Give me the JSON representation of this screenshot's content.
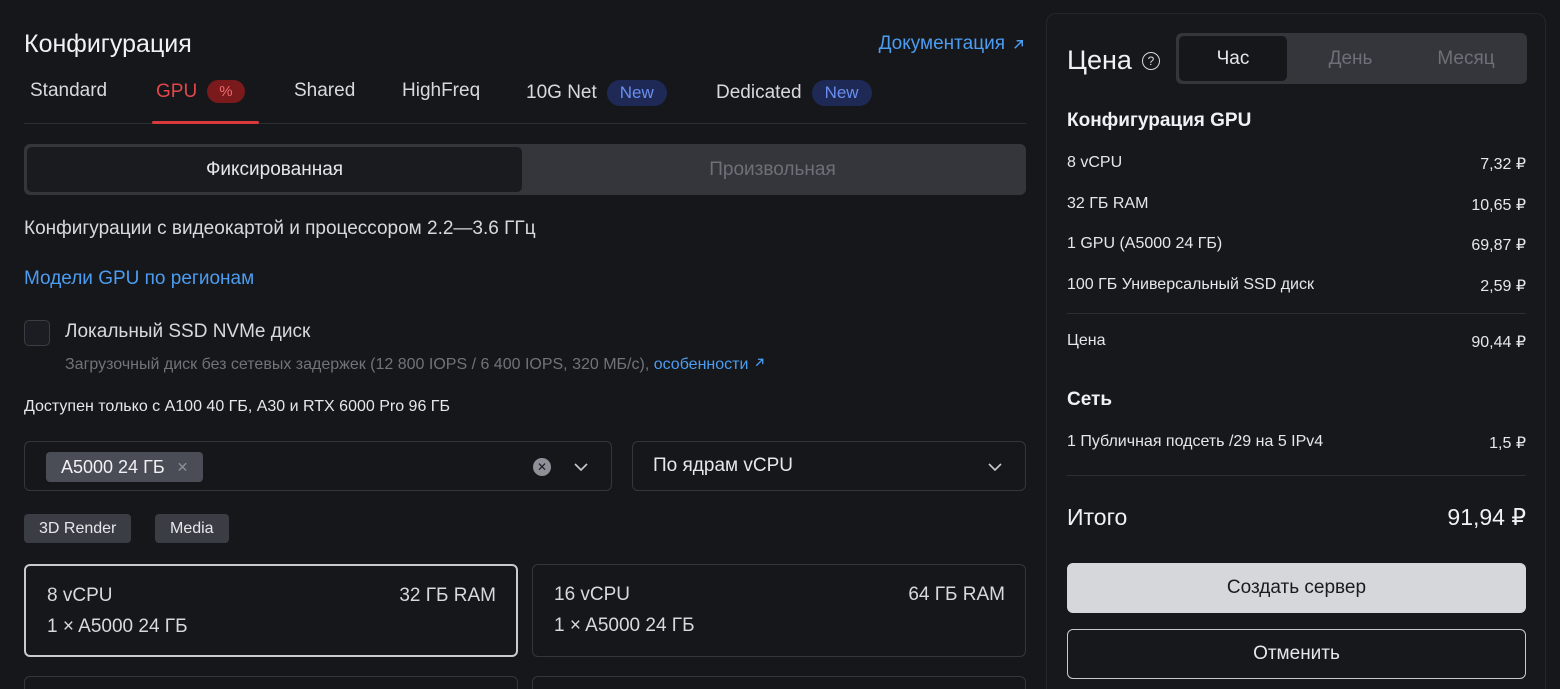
{
  "config": {
    "title": "Конфигурация",
    "doc_link": "Документация",
    "tabs": [
      {
        "label": "Standard"
      },
      {
        "label": "GPU",
        "badge": "%"
      },
      {
        "label": "Shared"
      },
      {
        "label": "HighFreq"
      },
      {
        "label": "10G Net",
        "badge": "New"
      },
      {
        "label": "Dedicated",
        "badge": "New"
      }
    ],
    "mode": {
      "fixed": "Фиксированная",
      "custom": "Произвольная"
    },
    "description": "Конфигурации с видеокартой и процессором 2.2—3.6 ГГц",
    "gpu_regions_link": "Модели GPU по регионам",
    "local_ssd": {
      "label": "Локальный SSD NVMe диск",
      "sub": "Загрузочный диск без сетевых задержек (12 800 IOPS / 6 400 IOPS, 320 МБ/с),",
      "sub_link": "особенности"
    },
    "availability": "Доступен только с A100 40 ГБ, A30 и RTX 6000 Pro 96 ГБ",
    "gpu_filter_chip": "A5000 24 ГБ",
    "sort_select": "По ядрам vCPU",
    "tags": [
      "3D Render",
      "Media"
    ],
    "cards": [
      {
        "cpu": "8 vCPU",
        "ram": "32 ГБ RAM",
        "gpu": "1 × A5000  24 ГБ"
      },
      {
        "cpu": "16 vCPU",
        "ram": "64 ГБ RAM",
        "gpu": "1 × A5000  24 ГБ"
      }
    ]
  },
  "price": {
    "title": "Цена",
    "periods": [
      "Час",
      "День",
      "Месяц"
    ],
    "gpu_section": "Конфигурация GPU",
    "items": [
      {
        "label": "8 vCPU",
        "value": "7,32 ₽"
      },
      {
        "label": "32 ГБ RAM",
        "value": "10,65 ₽"
      },
      {
        "label": "1 GPU (A5000 24 ГБ)",
        "value": "69,87 ₽"
      },
      {
        "label": "100 ГБ Универсальный SSD диск",
        "value": "2,59 ₽"
      }
    ],
    "subtotal": {
      "label": "Цена",
      "value": "90,44 ₽"
    },
    "network_section": "Сеть",
    "network": {
      "label": "1 Публичная подсеть /29 на 5 IPv4",
      "value": "1,5 ₽"
    },
    "total": {
      "label": "Итого",
      "value": "91,94 ₽"
    },
    "create_button": "Создать сервер",
    "cancel_button": "Отменить"
  }
}
